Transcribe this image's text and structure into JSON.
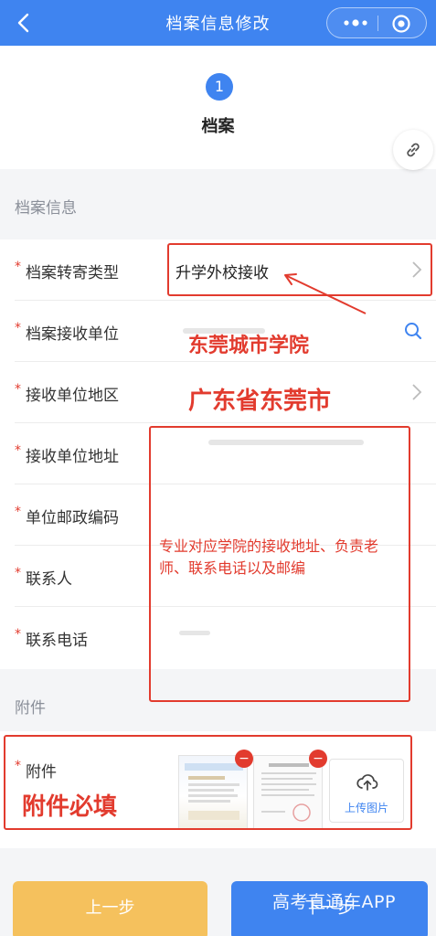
{
  "navbar": {
    "title": "档案信息修改",
    "back_icon": "chevron-left-icon",
    "more_icon": "more-dots-icon",
    "close_icon": "target-close-icon"
  },
  "steps": {
    "current_number": "1",
    "current_label": "档案"
  },
  "sections": {
    "archive_info": "档案信息",
    "attachment": "附件"
  },
  "form": {
    "rows": [
      {
        "required": "*",
        "label": "档案转寄类型",
        "value": "升学外校接收"
      },
      {
        "required": "*",
        "label": "档案接收单位",
        "value": ""
      },
      {
        "required": "*",
        "label": "接收单位地区",
        "value": ""
      },
      {
        "required": "*",
        "label": "接收单位地址",
        "value": ""
      },
      {
        "required": "*",
        "label": "单位邮政编码",
        "value": ""
      },
      {
        "required": "*",
        "label": "联系人",
        "value": ""
      },
      {
        "required": "*",
        "label": "联系电话",
        "value": ""
      }
    ]
  },
  "attachment": {
    "required": "*",
    "label": "附件",
    "delete_glyph": "−",
    "upload_label": "上传图片"
  },
  "buttons": {
    "prev": "上一步",
    "next": "下一步"
  },
  "annotations": {
    "receiving_unit": "东莞城市学院",
    "region": "广东省东莞市",
    "note": "专业对应学院的接收地址、负责老师、联系电话以及邮编",
    "attachment_required": "附件必填",
    "color": "#e23b2e"
  },
  "watermark": "高考直通车APP",
  "colors": {
    "primary": "#3f84f0",
    "prev_button": "#f5c15d",
    "required": "#e23b2e"
  }
}
